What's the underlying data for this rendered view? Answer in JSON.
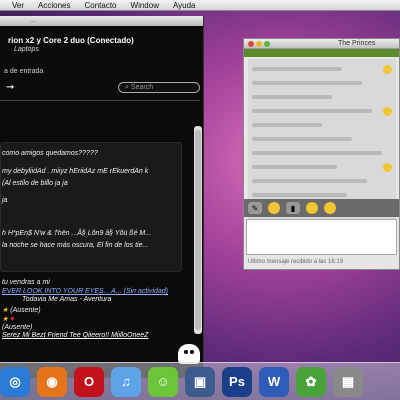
{
  "menubar": {
    "items": [
      "Ver",
      "Acciones",
      "Contacto",
      "Window",
      "Ayuda"
    ]
  },
  "messenger": {
    "title_fragment": "…",
    "status_line": "rion x2 y Core 2 duo (Conectado)",
    "sub_line": "Laptops",
    "inbox_label": "a de entrada",
    "search_placeholder": "Search",
    "contacts": [
      "como amigos quedamos?????",
      "my debyliidAd . miiyz hEriidAz mE rEkuerdAn k",
      "(Al estilo  de billo ja ja",
      "ja",
      "h H*pEn$ N'w & †hën ...Â§ Lõn9 â§ Yõü ßé M...",
      "la noche se hace más oscura, El fin de los tie...",
      "tu vendras a mi",
      "EVER LOOK INTO YOUR EYES...     A...  (Sin actividad)",
      "Todavia Me Amas - Aventura",
      "(Ausente)",
      "(Ausente)",
      "Serez Mi Bezt Friend Tee Qiieero!! MiilloOneeZ"
    ]
  },
  "chat": {
    "title": "The Princes",
    "footer": "Ultimo mensaje recibido a las 16:19"
  },
  "dock": {
    "apps": [
      {
        "name": "safari",
        "color": "#2a7bd6",
        "glyph": "◎"
      },
      {
        "name": "firefox",
        "color": "#e3741c",
        "glyph": "◉"
      },
      {
        "name": "opera",
        "color": "#c4121c",
        "glyph": "O"
      },
      {
        "name": "itunes",
        "color": "#5ea3e8",
        "glyph": "♫"
      },
      {
        "name": "adium",
        "color": "#6cc43a",
        "glyph": "☺"
      },
      {
        "name": "iphoto",
        "color": "#3d5b8c",
        "glyph": "▣"
      },
      {
        "name": "photoshop",
        "color": "#1c3f8c",
        "glyph": "Ps"
      },
      {
        "name": "word",
        "color": "#2e5cb8",
        "glyph": "W"
      },
      {
        "name": "messenger",
        "color": "#4aa23a",
        "glyph": "✿"
      },
      {
        "name": "utility",
        "color": "#8a8a8a",
        "glyph": "▦"
      }
    ]
  }
}
